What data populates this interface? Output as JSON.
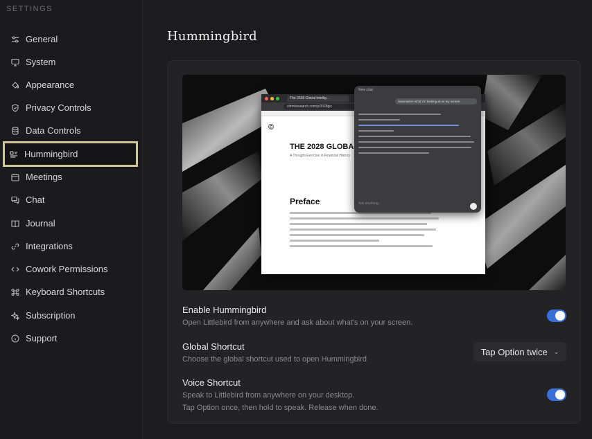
{
  "sidebar": {
    "section_label": "SETTINGS",
    "items": [
      {
        "label": "General",
        "icon": "sliders-icon"
      },
      {
        "label": "System",
        "icon": "monitor-icon"
      },
      {
        "label": "Appearance",
        "icon": "paint-bucket-icon"
      },
      {
        "label": "Privacy Controls",
        "icon": "shield-icon"
      },
      {
        "label": "Data Controls",
        "icon": "database-icon"
      },
      {
        "label": "Hummingbird",
        "icon": "hummingbird-icon",
        "active": true
      },
      {
        "label": "Meetings",
        "icon": "calendar-icon"
      },
      {
        "label": "Chat",
        "icon": "chat-bubbles-icon"
      },
      {
        "label": "Journal",
        "icon": "book-icon"
      },
      {
        "label": "Integrations",
        "icon": "link-icon"
      },
      {
        "label": "Cowork Permissions",
        "icon": "code-icon"
      },
      {
        "label": "Keyboard Shortcuts",
        "icon": "command-icon"
      },
      {
        "label": "Subscription",
        "icon": "sparkle-icon"
      },
      {
        "label": "Support",
        "icon": "info-icon"
      }
    ]
  },
  "main": {
    "title": "Hummingbird",
    "preview": {
      "browser_tab": "The 2028 Global Intellig...",
      "browser_url": "citriniresearch.com/p/2028gic",
      "article_title": "THE 2028 GLOBAL",
      "article_subtitle": "A Thought Exercise in Financial History",
      "article_heading": "Preface",
      "chat_header": "New chat",
      "chat_question": "Summarize what I'm looking at on my screen",
      "chat_input_placeholder": "Ask anything..."
    },
    "settings": {
      "enable": {
        "title": "Enable Hummingbird",
        "description": "Open Littlebird from anywhere and ask about what's on your screen.",
        "enabled": true
      },
      "global_shortcut": {
        "title": "Global Shortcut",
        "description": "Choose the global shortcut used to open Hummingbird",
        "value": "Tap Option twice"
      },
      "voice": {
        "title": "Voice Shortcut",
        "description_line1": "Speak to Littlebird from anywhere on your desktop.",
        "description_line2": "Tap Option once, then hold to speak. Release when done.",
        "enabled": true
      }
    }
  },
  "colors": {
    "accent": "#3b6fd8",
    "active_outline": "#cfc69a",
    "background": "#1c1c1e"
  }
}
